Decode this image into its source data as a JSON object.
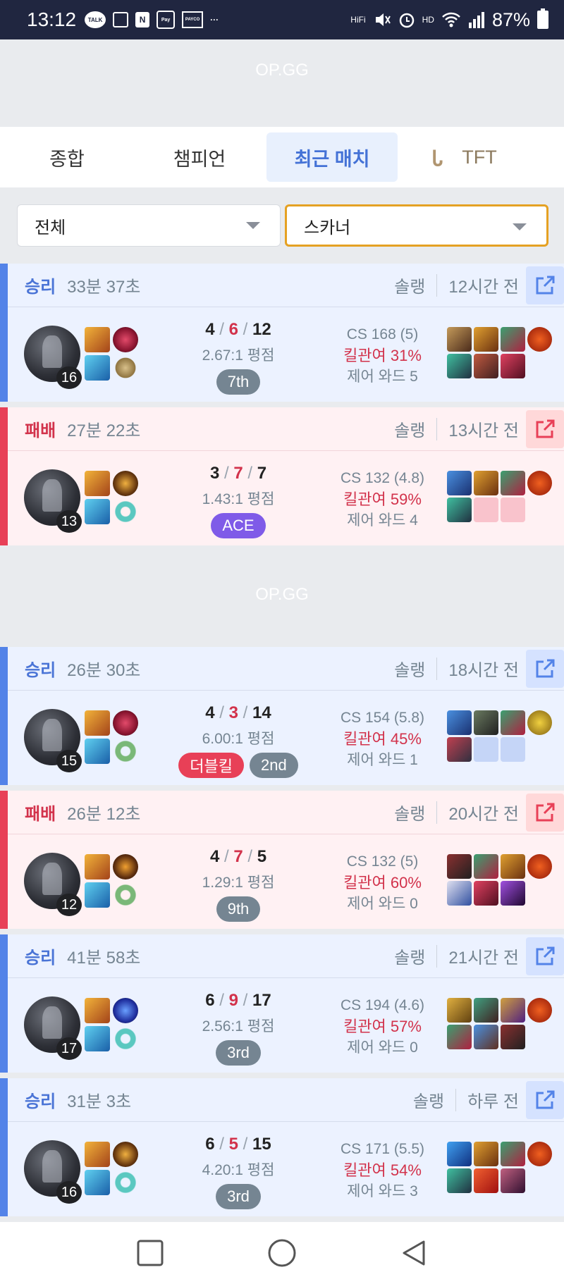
{
  "status_bar": {
    "time": "13:12",
    "battery": "87%",
    "talk": "TALK",
    "n": "N",
    "pay": "Pay",
    "payco": "PAYCO",
    "more": "···",
    "hifi": "HiFi",
    "hd": "HD"
  },
  "banner_top": "OP.GG",
  "banner_mid": "OP.GG",
  "tabs": [
    {
      "label": "종합"
    },
    {
      "label": "챔피언"
    },
    {
      "label": "최근 매치",
      "active": true
    },
    {
      "label": "TFT"
    }
  ],
  "filters": {
    "left": "전체",
    "right": "스카너"
  },
  "colors": {
    "win_bar": "#5383e8",
    "loss_bar": "#e84057",
    "win_bg": "#ecf2ff",
    "loss_bg": "#fff1f3",
    "ace": "#7f5be8"
  },
  "matches": [
    {
      "result": "승리",
      "duration": "33분 37초",
      "queue": "솔랭",
      "ago": "12시간 전",
      "level": "16",
      "k": "4",
      "d": "6",
      "a": "12",
      "ratio": "2.67:1 평점",
      "badges": [
        "7th"
      ],
      "cs": "CS 168 (5)",
      "kp": "킬관여 31%",
      "ward": "제어 와드 5"
    },
    {
      "result": "패배",
      "duration": "27분 22초",
      "queue": "솔랭",
      "ago": "13시간 전",
      "level": "13",
      "k": "3",
      "d": "7",
      "a": "7",
      "ratio": "1.43:1 평점",
      "badges": [
        "ACE"
      ],
      "cs": "CS 132 (4.8)",
      "kp": "킬관여 59%",
      "ward": "제어 와드 4"
    },
    {
      "result": "승리",
      "duration": "26분 30초",
      "queue": "솔랭",
      "ago": "18시간 전",
      "level": "15",
      "k": "4",
      "d": "3",
      "a": "14",
      "ratio": "6.00:1 평점",
      "badges": [
        "더블킬",
        "2nd"
      ],
      "cs": "CS 154 (5.8)",
      "kp": "킬관여 45%",
      "ward": "제어 와드 1"
    },
    {
      "result": "패배",
      "duration": "26분 12초",
      "queue": "솔랭",
      "ago": "20시간 전",
      "level": "12",
      "k": "4",
      "d": "7",
      "a": "5",
      "ratio": "1.29:1 평점",
      "badges": [
        "9th"
      ],
      "cs": "CS 132 (5)",
      "kp": "킬관여 60%",
      "ward": "제어 와드 0"
    },
    {
      "result": "승리",
      "duration": "41분 58초",
      "queue": "솔랭",
      "ago": "21시간 전",
      "level": "17",
      "k": "6",
      "d": "9",
      "a": "17",
      "ratio": "2.56:1 평점",
      "badges": [
        "3rd"
      ],
      "cs": "CS 194 (4.6)",
      "kp": "킬관여 57%",
      "ward": "제어 와드 0"
    },
    {
      "result": "승리",
      "duration": "31분 3초",
      "queue": "솔랭",
      "ago": "하루 전",
      "level": "16",
      "k": "6",
      "d": "5",
      "a": "15",
      "ratio": "4.20:1 평점",
      "badges": [
        "3rd"
      ],
      "cs": "CS 171 (5.5)",
      "kp": "킬관여 54%",
      "ward": "제어 와드 3"
    }
  ]
}
